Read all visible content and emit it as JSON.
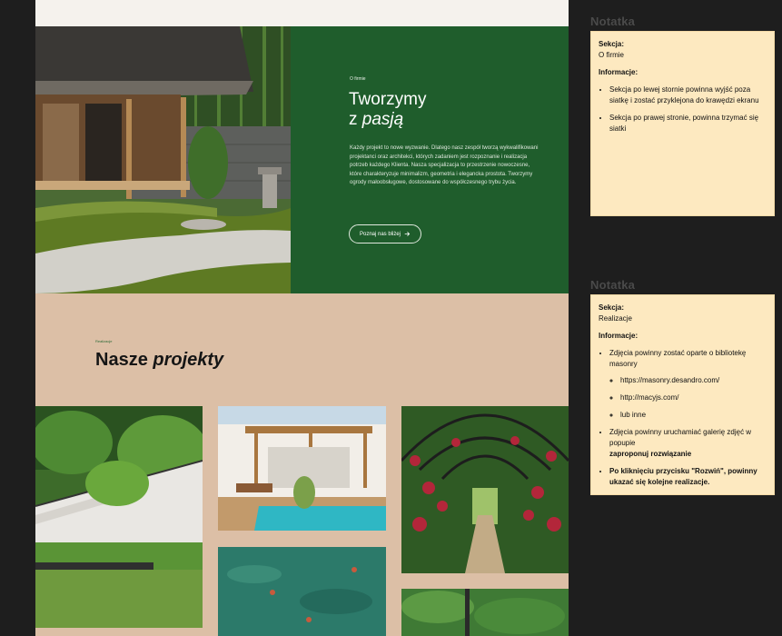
{
  "about": {
    "eyebrow": "O firmie",
    "title_line1": "Tworzymy",
    "title_line2_prefix": "z ",
    "title_line2_italic": "pasją",
    "body": "Każdy projekt to nowe wyzwanie. Dlatego nasz zespół tworzą wykwalifikowani projektanci oraz architekci, których zadaniem jest rozpoznanie i realizacja potrzeb każdego Klienta. Nasza specjalizacja to przestrzenie nowoczesne, które charakteryzuje minimalizm, geometria i elegancka prostota. Tworzymy ogrody małoobsługowe, dostosowane do współczesnego trybu życia.",
    "button_label": "Poznaj nas bliżej",
    "button_icon": "arrow-right-icon",
    "accent_color": "#1f5d2c"
  },
  "projects": {
    "eyebrow": "Realizacje",
    "title_prefix": "Nasze ",
    "title_italic": "projekty",
    "background_color": "#dcbfa6"
  },
  "notes": [
    {
      "heading": "Notatka",
      "section_label": "Sekcja:",
      "section_value": "O firmie",
      "info_label": "Informacje:",
      "items": [
        "Sekcja po lewej stornie powinna wyjść poza siatkę i zostać przyklejona do krawędzi ekranu",
        "Sekcja po prawej stronie, powinna trzymać się siatki"
      ]
    },
    {
      "heading": "Notatka",
      "section_label": "Sekcja:",
      "section_value": "Realizacje",
      "info_label": "Informacje:",
      "item1": "Zdjęcia powinny zostać oparte o bibliotekę masonry",
      "sub_items": [
        "https://masonry.desandro.com/",
        "http://macyjs.com/",
        "lub inne"
      ],
      "item2_text": "Zdjęcia powinny uruchamiać galerię zdjęć w popupie",
      "item2_bold": "zaproponuj rozwiązanie",
      "item3": "Po kliknięciu przycisku \"Rozwiń\", powinny ukazać się kolejne realizacje."
    }
  ]
}
